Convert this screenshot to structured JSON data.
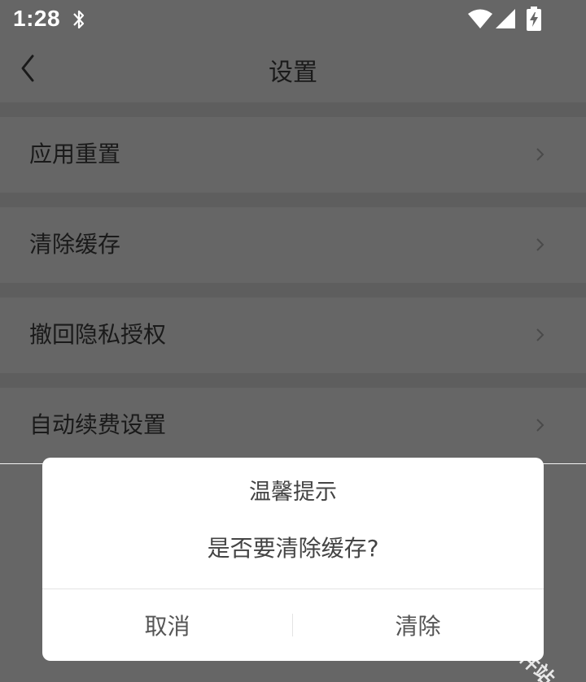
{
  "status_bar": {
    "time": "1:28",
    "icons": [
      "bluetooth-icon",
      "wifi-icon",
      "signal-icon",
      "battery-charging-icon"
    ]
  },
  "nav": {
    "title": "设置",
    "back_icon": "chevron-left-icon"
  },
  "settings": {
    "items": [
      {
        "label": "应用重置"
      },
      {
        "label": "清除缓存"
      },
      {
        "label": "撤回隐私授权"
      },
      {
        "label": "自动续费设置"
      }
    ]
  },
  "dialog": {
    "title": "温馨提示",
    "message": "是否要清除缓存?",
    "cancel_label": "取消",
    "confirm_label": "清除"
  },
  "watermark": {
    "text": "千章软件站"
  },
  "colors": {
    "overlay": "#666666",
    "dialog_bg": "#ffffff",
    "text_dark": "#1a1a1a",
    "dialog_text": "#444444"
  }
}
